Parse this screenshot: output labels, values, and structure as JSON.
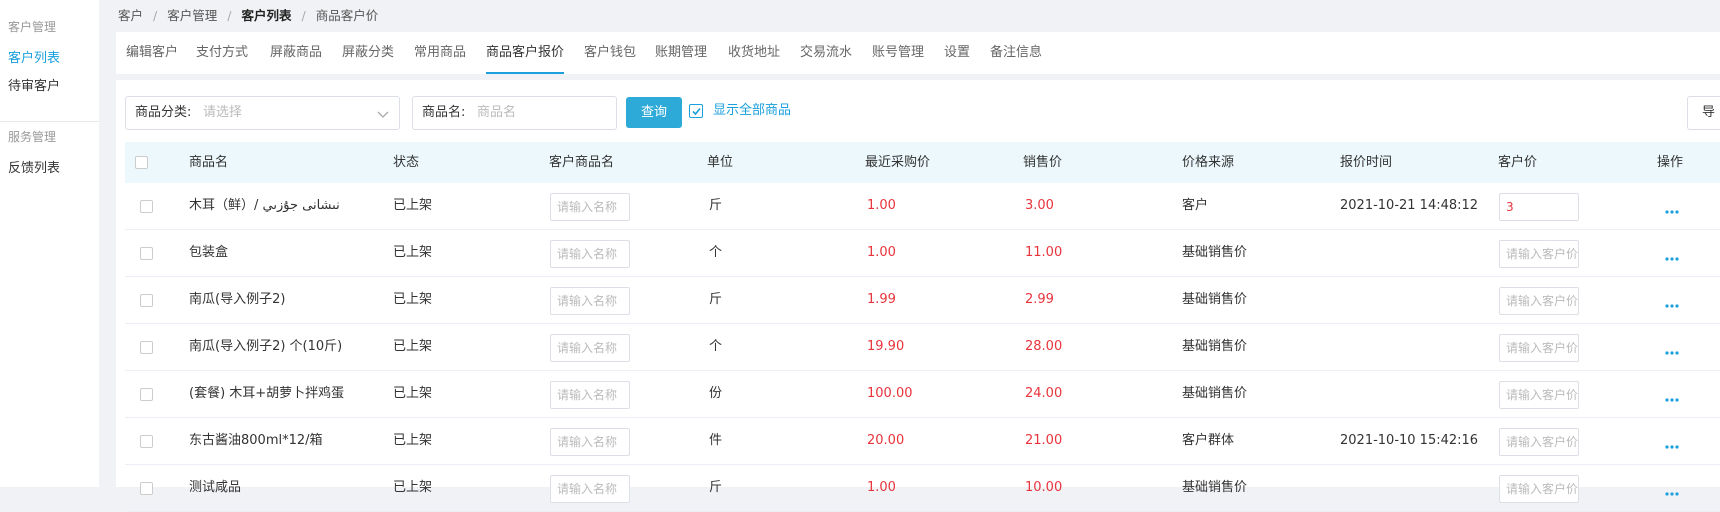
{
  "sidebar": {
    "section1": "客户管理",
    "items1": [
      {
        "label": "客户列表"
      },
      {
        "label": "待审客户"
      }
    ],
    "section2": "服务管理",
    "items2": [
      {
        "label": "反馈列表"
      }
    ]
  },
  "breadcrumb": [
    "客户",
    "客户管理",
    "客户列表",
    "商品客户价"
  ],
  "tabs": [
    {
      "label": "编辑客户"
    },
    {
      "label": "支付方式"
    },
    {
      "label": "屏蔽商品"
    },
    {
      "label": "屏蔽分类"
    },
    {
      "label": "常用商品"
    },
    {
      "label": "商品客户报价"
    },
    {
      "label": "客户钱包"
    },
    {
      "label": "账期管理"
    },
    {
      "label": "收货地址"
    },
    {
      "label": "交易流水"
    },
    {
      "label": "账号管理"
    },
    {
      "label": "设置"
    },
    {
      "label": "备注信息"
    }
  ],
  "active_tab": "商品客户报价",
  "filters": {
    "category_label": "商品分类:",
    "category_placeholder": "请选择",
    "name_label": "商品名:",
    "name_placeholder": "商品名",
    "query_button": "查询",
    "show_all_label": "显示全部商品",
    "show_all_checked": true,
    "export_button": "导"
  },
  "table": {
    "headers": [
      "商品名",
      "状态",
      "客户商品名",
      "单位",
      "最近采购价",
      "销售价",
      "价格来源",
      "报价时间",
      "客户价",
      "操作"
    ],
    "name_placeholder": "请输入名称",
    "price_placeholder": "请输入客户价",
    "rows": [
      {
        "name": "木耳（鲜）/ نىشانى جۇزىي",
        "status": "已上架",
        "unit": "斤",
        "last_price": "1.00",
        "sale_price": "3.00",
        "source": "客户",
        "time": "2021-10-21 14:48:12",
        "customer_price": "3"
      },
      {
        "name": "包装盒",
        "status": "已上架",
        "unit": "个",
        "last_price": "1.00",
        "sale_price": "11.00",
        "source": "基础销售价",
        "time": "",
        "customer_price": ""
      },
      {
        "name": "南瓜(导入例子2)",
        "status": "已上架",
        "unit": "斤",
        "last_price": "1.99",
        "sale_price": "2.99",
        "source": "基础销售价",
        "time": "",
        "customer_price": ""
      },
      {
        "name": "南瓜(导入例子2) 个(10斤)",
        "status": "已上架",
        "unit": "个",
        "last_price": "19.90",
        "sale_price": "28.00",
        "source": "基础销售价",
        "time": "",
        "customer_price": ""
      },
      {
        "name": "(套餐) 木耳+胡萝卜拌鸡蛋",
        "status": "已上架",
        "unit": "份",
        "last_price": "100.00",
        "sale_price": "24.00",
        "source": "基础销售价",
        "time": "",
        "customer_price": ""
      },
      {
        "name": "东古酱油800ml*12/箱",
        "status": "已上架",
        "unit": "件",
        "last_price": "20.00",
        "sale_price": "21.00",
        "source": "客户群体",
        "time": "2021-10-10 15:42:16",
        "customer_price": ""
      },
      {
        "name": "测试咸品",
        "status": "已上架",
        "unit": "斤",
        "last_price": "1.00",
        "sale_price": "10.00",
        "source": "基础销售价",
        "time": "",
        "customer_price": ""
      }
    ]
  },
  "colors": {
    "accent": "#1aa0dc",
    "price_red": "#e8343c",
    "header_bg": "#ecf8fc",
    "query_btn": "#2eaad8"
  }
}
